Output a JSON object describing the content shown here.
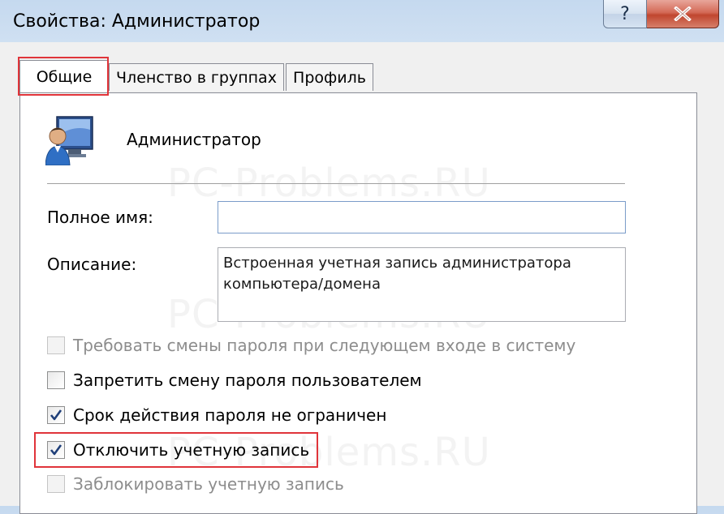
{
  "window": {
    "title": "Свойства: Администратор",
    "help_label": "?",
    "close_icon": "close-icon"
  },
  "tabs": [
    {
      "label": "Общие",
      "active": true
    },
    {
      "label": "Членство в группах",
      "active": false
    },
    {
      "label": "Профиль",
      "active": false
    }
  ],
  "user": {
    "name": "Администратор",
    "avatar_icon": "user-monitor-icon"
  },
  "watermark": "PC-Problems.RU",
  "fields": {
    "full_name_label": "Полное имя:",
    "full_name_value": "",
    "description_label": "Описание:",
    "description_value": "Встроенная учетная запись администратора компьютера/домена"
  },
  "options": [
    {
      "label": "Требовать смены пароля при следующем входе в систему",
      "checked": false,
      "enabled": false
    },
    {
      "label": "Запретить смену пароля пользователем",
      "checked": false,
      "enabled": true
    },
    {
      "label": "Срок действия пароля не ограничен",
      "checked": true,
      "enabled": true
    },
    {
      "label": "Отключить учетную запись",
      "checked": true,
      "enabled": true
    },
    {
      "label": "Заблокировать учетную запись",
      "checked": false,
      "enabled": false
    }
  ],
  "colors": {
    "highlight": "#e0343a",
    "checkmark": "#1f3f79"
  }
}
